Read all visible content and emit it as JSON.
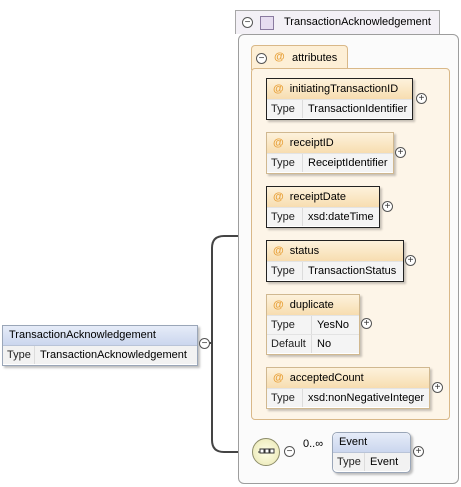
{
  "root_element": {
    "name": "TransactionAcknowledgement",
    "type_key": "Type",
    "type_value": "TransactionAcknowledgement"
  },
  "complex_type": {
    "name": "TransactionAcknowledgement"
  },
  "attributes_group": {
    "label": "attributes",
    "symbol": "@",
    "items": [
      {
        "name": "initiatingTransactionID",
        "rows": [
          {
            "key": "Type",
            "value": "TransactionIdentifier"
          }
        ]
      },
      {
        "name": "receiptID",
        "rows": [
          {
            "key": "Type",
            "value": "ReceiptIdentifier"
          }
        ]
      },
      {
        "name": "receiptDate",
        "rows": [
          {
            "key": "Type",
            "value": "xsd:dateTime"
          }
        ]
      },
      {
        "name": "status",
        "rows": [
          {
            "key": "Type",
            "value": "TransactionStatus"
          }
        ]
      },
      {
        "name": "duplicate",
        "rows": [
          {
            "key": "Type",
            "value": "YesNo"
          },
          {
            "key": "Default",
            "value": "No"
          }
        ]
      },
      {
        "name": "acceptedCount",
        "rows": [
          {
            "key": "Type",
            "value": "xsd:nonNegativeInteger"
          }
        ]
      }
    ]
  },
  "event_element": {
    "name": "Event",
    "type_key": "Type",
    "type_value": "Event",
    "cardinality": "0..∞"
  },
  "symbols": {
    "collapse": "⊖",
    "expand": "+",
    "minus": "−"
  }
}
